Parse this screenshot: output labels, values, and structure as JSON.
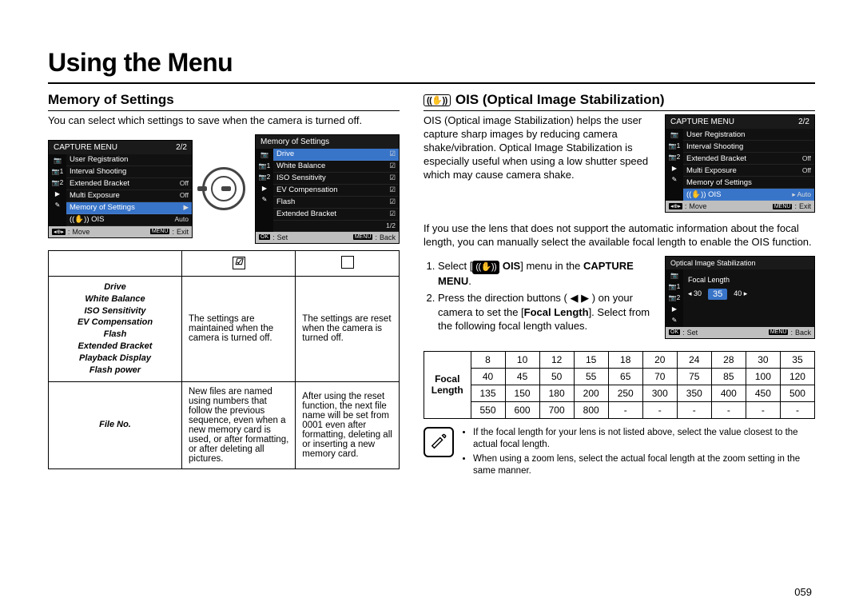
{
  "page_title": "Using the Menu",
  "page_number": "059",
  "left": {
    "heading": "Memory of Settings",
    "intro": "You can select which settings to save when the camera is turned off.",
    "lcd_capture": {
      "title": "CAPTURE MENU",
      "page": "2/2",
      "sidebar": [
        "📷",
        "📷1",
        "📷2",
        "▶",
        "✎"
      ],
      "rows": [
        {
          "label": "User Registration",
          "val": ""
        },
        {
          "label": "Interval Shooting",
          "val": ""
        },
        {
          "label": "Extended Bracket",
          "val": "Off"
        },
        {
          "label": "Multi Exposure",
          "val": "Off"
        },
        {
          "label": "Memory of Settings",
          "val": "▶",
          "sel": true
        },
        {
          "label": "((✋)) OIS",
          "val": "Auto"
        }
      ],
      "foot_left_key": "◂⊕▸",
      "foot_left": "Move",
      "foot_right_key": "MENU",
      "foot_right": "Exit"
    },
    "lcd_memory": {
      "title": "Memory of Settings",
      "sidebar": [
        "📷",
        "📷1",
        "📷2",
        "▶",
        "✎"
      ],
      "rows": [
        {
          "label": "Drive",
          "val": "☑"
        },
        {
          "label": "White Balance",
          "val": "☑"
        },
        {
          "label": "ISO Sensitivity",
          "val": "☑"
        },
        {
          "label": "EV Compensation",
          "val": "☑"
        },
        {
          "label": "Flash",
          "val": "☑"
        },
        {
          "label": "Extended Bracket",
          "val": "☑"
        }
      ],
      "page": "1/2",
      "foot_left_key": "OK",
      "foot_left": "Set",
      "foot_right_key": "MENU",
      "foot_right": "Back"
    },
    "table": {
      "header_checked": "☑",
      "header_empty": "☐",
      "row1_names": "Drive\nWhite Balance\nISO Sensitivity\nEV Compensation\nFlash\nExtended Bracket\nPlayback Display\nFlash power",
      "row1_checked": "The settings are maintained when the camera is turned off.",
      "row1_empty": "The settings are reset when the camera is turned off.",
      "row2_name": "File No.",
      "row2_checked": "New files are named using numbers that follow the previous sequence, even when a new memory card is used, or after formatting, or after deleting all pictures.",
      "row2_empty": "After using the reset function, the next file name will be set from 0001 even after formatting, deleting all or inserting a new memory card."
    }
  },
  "right": {
    "heading": "OIS (Optical Image Stabilization)",
    "ois_icon_text": "((✋))",
    "intro": "OIS (Optical image Stabilization) helps the user capture sharp images by reducing camera shake/vibration. Optical Image Stabilization is especially useful when using a low shutter speed which may cause camera shake.",
    "lcd_capture2": {
      "title": "CAPTURE MENU",
      "page": "2/2",
      "sidebar": [
        "📷",
        "📷1",
        "📷2",
        "▶",
        "✎"
      ],
      "rows": [
        {
          "label": "User Registration",
          "val": ""
        },
        {
          "label": "Interval Shooting",
          "val": ""
        },
        {
          "label": "Extended Bracket",
          "val": "Off"
        },
        {
          "label": "Multi Exposure",
          "val": "Off"
        },
        {
          "label": "Memory of Settings",
          "val": ""
        },
        {
          "label": "((✋)) OIS",
          "val": "▸ Auto",
          "sel": true
        }
      ],
      "foot_left_key": "◂⊕▸",
      "foot_left": "Move",
      "foot_right_key": "MENU",
      "foot_right": "Exit"
    },
    "lens_note": "If you use the lens that does not support the automatic information about the focal length, you can manually select the available focal length to enable the OIS function.",
    "steps": {
      "s1_a": "Select [",
      "s1_b": " OIS",
      "s1_c": "] menu in the ",
      "s1_d": "CAPTURE MENU",
      "s1_e": ".",
      "s2_a": "Press the direction buttons ( ◀ ▶ ) on your camera to set the [",
      "s2_b": "Focal Length",
      "s2_c": "]. Select from the following focal length values."
    },
    "lcd_focal": {
      "title": "Optical Image Stabilization",
      "sidebar": [
        "📷",
        "📷1",
        "📷2",
        "▶",
        "✎"
      ],
      "focal_label": "Focal Length",
      "values": [
        "◂ 30",
        "35",
        "40 ▸"
      ],
      "foot_left_key": "OK",
      "foot_left": "Set",
      "foot_right_key": "MENU",
      "foot_right": "Back"
    },
    "focal_table": {
      "label1": "Focal",
      "label2": "Length",
      "rows": [
        [
          "8",
          "10",
          "12",
          "15",
          "18",
          "20",
          "24",
          "28",
          "30",
          "35"
        ],
        [
          "40",
          "45",
          "50",
          "55",
          "65",
          "70",
          "75",
          "85",
          "100",
          "120"
        ],
        [
          "135",
          "150",
          "180",
          "200",
          "250",
          "300",
          "350",
          "400",
          "450",
          "500"
        ],
        [
          "550",
          "600",
          "700",
          "800",
          "-",
          "-",
          "-",
          "-",
          "-",
          "-"
        ]
      ]
    },
    "notes": {
      "n1": "If the focal length for your lens is not listed above, select the value closest to the actual focal length.",
      "n2": "When using a zoom lens, select the actual focal length at the zoom setting in the same manner."
    }
  }
}
